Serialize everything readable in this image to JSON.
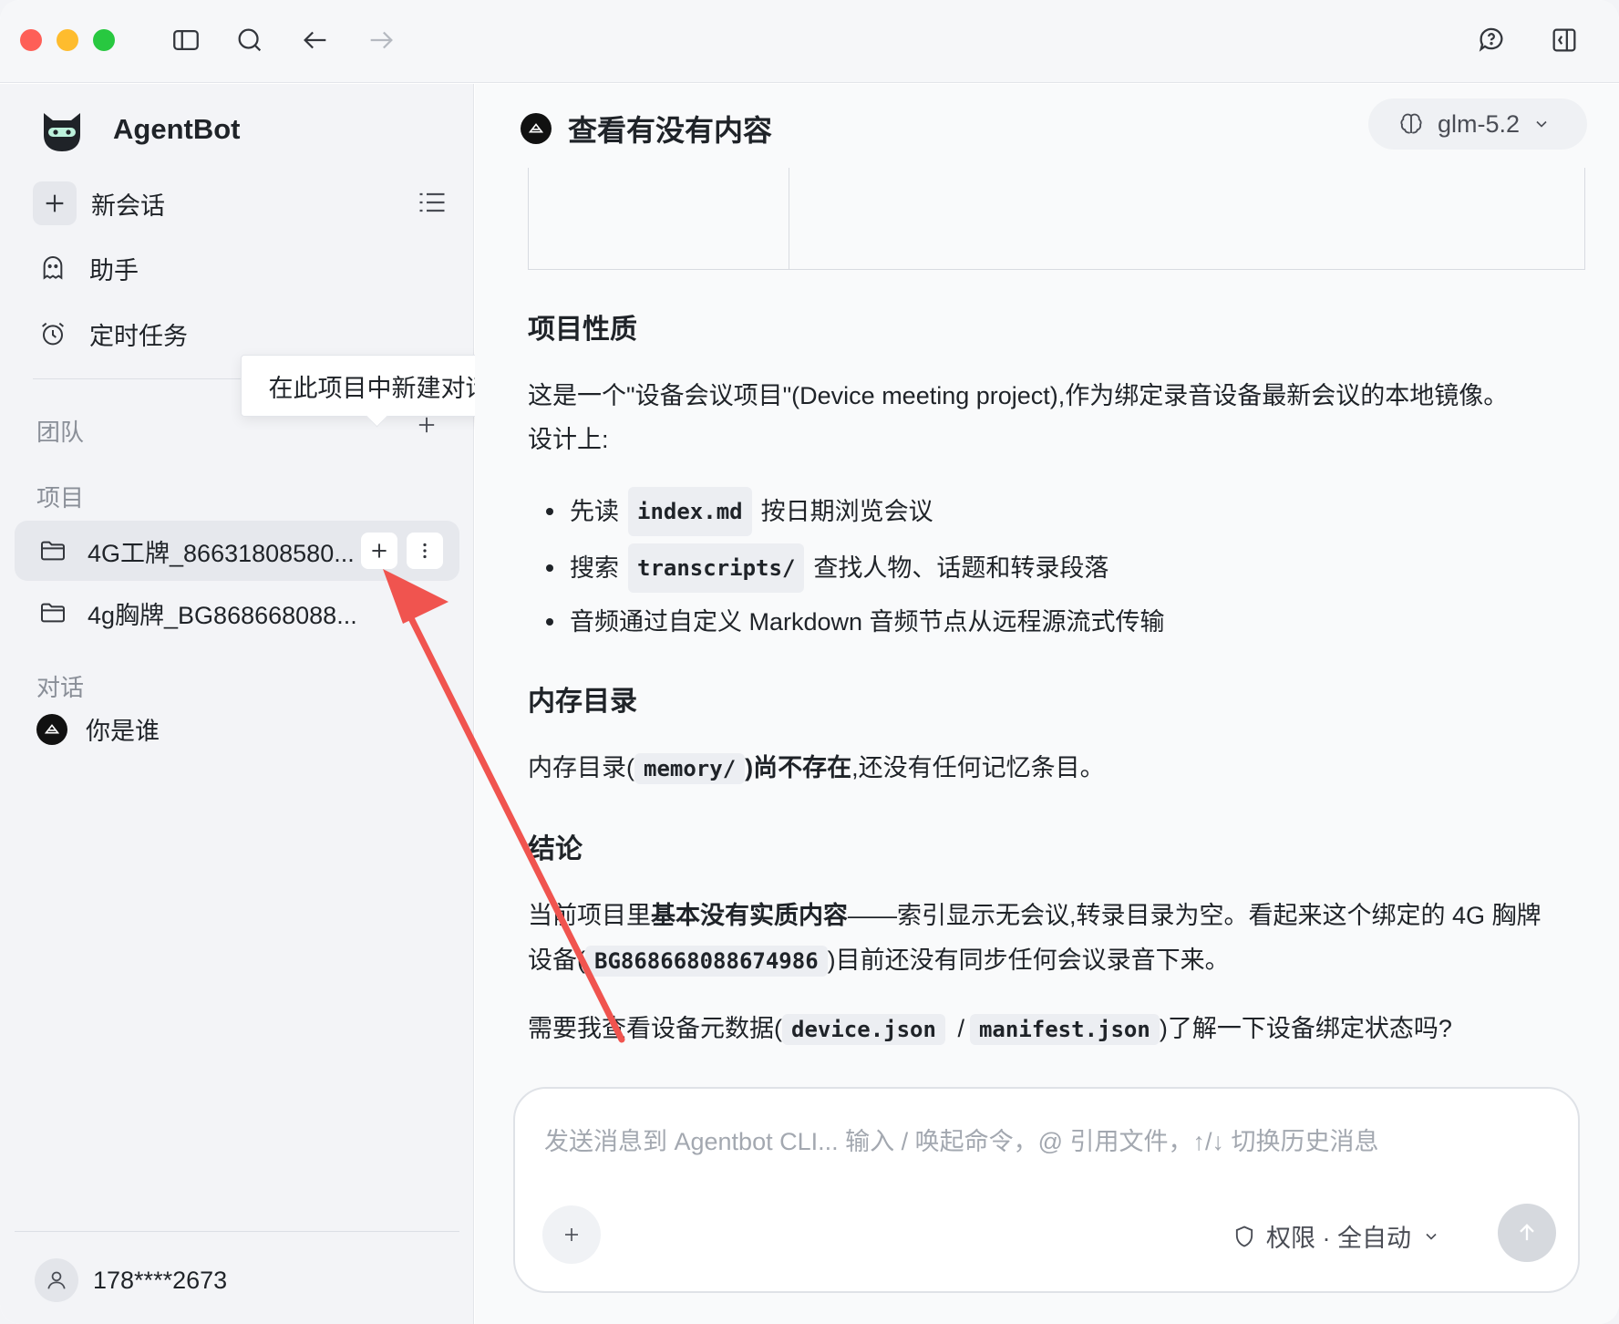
{
  "app": {
    "name": "AgentBot"
  },
  "sidebar": {
    "new_chat": "新会话",
    "assistant": "助手",
    "scheduled": "定时任务",
    "section_team": "团队",
    "section_projects": "项目",
    "section_chats": "对话",
    "projects": [
      {
        "name": "4G工牌_86631808580..."
      },
      {
        "name": "4g胸牌_BG868668088..."
      }
    ],
    "chats": [
      {
        "name": "你是谁"
      }
    ],
    "tooltip": "在此项目中新建对话",
    "user": "178****2673"
  },
  "header": {
    "chat_title": "查看有没有内容",
    "model": "glm-5.2"
  },
  "content": {
    "h_nature": "项目性质",
    "p_nature_1": "这是一个\"设备会议项目\"(Device meeting project),作为绑定录音设备最新会议的本地镜像。",
    "p_nature_2": "设计上:",
    "bullets": [
      {
        "pre": "先读",
        "code": "index.md",
        "post": "按日期浏览会议"
      },
      {
        "pre": "搜索",
        "code": "transcripts/",
        "post": "查找人物、话题和转录段落"
      },
      {
        "pre": "音频通过自定义 Markdown 音频节点从远程源流式传输",
        "code": "",
        "post": ""
      }
    ],
    "h_memory": "内存目录",
    "p_memory_pre": "内存目录(",
    "p_memory_code": "memory/",
    "p_memory_bold": ")尚不存在",
    "p_memory_post": ",还没有任何记忆条目。",
    "h_conclusion": "结论",
    "p_concl_pre": "当前项目里",
    "p_concl_bold": "基本没有实质内容",
    "p_concl_post": "——索引显示无会议,转录目录为空。看起来这个绑定的 4G 胸牌",
    "p_concl_line2_pre": "设备(",
    "p_concl_code": "BG868668088674986",
    "p_concl_line2_post": ")目前还没有同步任何会议录音下来。",
    "p_ask_pre": "需要我查看设备元数据(",
    "p_ask_code1": "device.json",
    "p_ask_sep": "/",
    "p_ask_code2": "manifest.json",
    "p_ask_post": ")了解一下设备绑定状态吗?"
  },
  "composer": {
    "placeholder": "发送消息到 Agentbot CLI...  输入 / 唤起命令，@ 引用文件，↑/↓ 切换历史消息",
    "permission": "权限 · 全自动"
  },
  "colors": {
    "annotation_arrow": "#f0544f",
    "accent": "#1f2328"
  }
}
